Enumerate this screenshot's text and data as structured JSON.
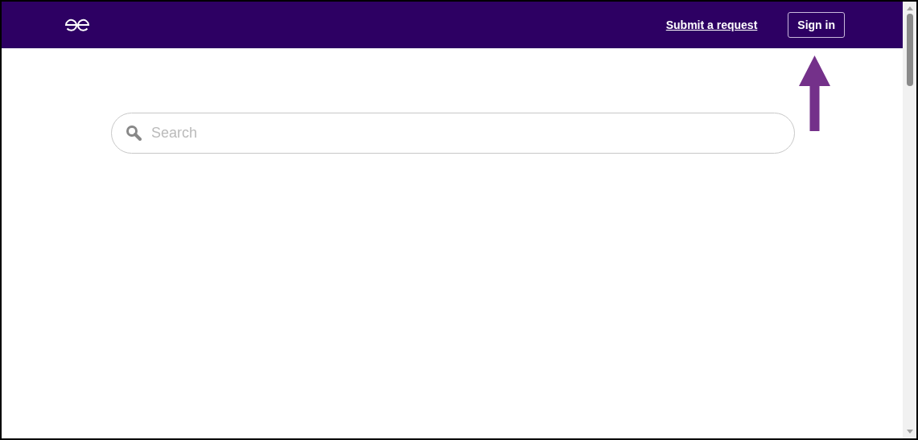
{
  "header": {
    "links": [
      {
        "label": "Submit a request",
        "kind": "link"
      },
      {
        "label": "Sign in",
        "kind": "button"
      }
    ]
  },
  "search": {
    "placeholder": "Search"
  }
}
